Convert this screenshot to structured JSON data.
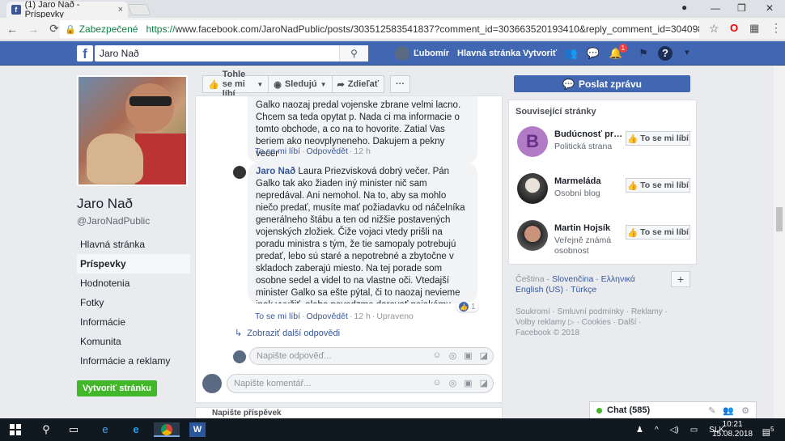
{
  "browser": {
    "tab_title": "(1) Jaro Nað - Príspevky",
    "tab_close": "×",
    "secure_label": "Zabezpečené",
    "url_scheme": "https://",
    "url_rest": "www.facebook.com/JaroNadPublic/posts/303512583541837?comment_id=303663520193410&reply_comment_id=304098803483215&com...",
    "win_min": "—",
    "win_max": "❐",
    "win_close": "✕",
    "back": "←",
    "forward": "→",
    "reload": "⟳",
    "star": "☆",
    "menu": "⋮"
  },
  "fb_header": {
    "search_value": "Jaro Nað",
    "user_name": "Ľubomír",
    "home": "Hlavná stránka",
    "create": "Vytvoriť",
    "notif_count": "1"
  },
  "page": {
    "name": "Jaro Nað",
    "handle": "@JaroNadPublic",
    "nav": [
      {
        "label": "Hlavná stránka"
      },
      {
        "label": "Príspevky"
      },
      {
        "label": "Hodnotenia"
      },
      {
        "label": "Fotky"
      },
      {
        "label": "Informácie"
      },
      {
        "label": "Komunita"
      },
      {
        "label": "Informácie a reklamy"
      }
    ],
    "create_page": "Vytvoriť stránku"
  },
  "actions": {
    "like": "Tohle se mi líbí",
    "follow": "Sledujú",
    "share": "Zdieľať",
    "more": "···"
  },
  "comments": {
    "first_text": "Galko naozaj predal vojenske zbrane velmi lacno. Chcem sa teda opytat p. Nada ci ma informacie o tomto obchode, a co na to hovorite. Zatial Vas beriem ako neovplyneneho. Dakujem a pekny vecer",
    "first_like": "To se mi líbí",
    "first_reply": "Odpovědět",
    "first_time": "12 h",
    "reply_author": "Jaro Nað",
    "reply_text": "Laura Priezvisková dobrý večer. Pán Galko tak ako žiaden iný minister nič sam nepredával. Ani nemohol. Na to, aby sa mohlo niečo predať, musíte mať požiadavku od náčelníka generálneho štábu a ten od nižšie postavených vojenských zložiek. Čiže vojaci vtedy prišli na poradu ministra s tým, že tie samopaly potrebujú predať, lebo sú staré a nepotrebné a zbytočne v skladoch zaberajú miesto. Na tej porade som osobne sedel a videl to na vlastne oči. Vtedajší minister Galko sa ešte pýtal, či to naozaj nevieme inak využiť, alebo povedzme darovať nejakému spojencovi. Prítomný najvyšší vojak povedal, že najlepšia alternatíva je predaj. No a cena bola stanovená na základe elektronickej aukcie. Kto dal viac, ten si to kúpil. Ostatné je iba politikárčenie. Galko v tom bol a je nevinne. Taký je fakt...",
    "reply_like": "To se mi líbí",
    "reply_reply": "Odpovědět",
    "reply_time": "12 h",
    "reply_edited": "Upraveno",
    "reply_reactions": "1",
    "more_replies": "Zobraziť další odpovědi",
    "reply_placeholder": "Napište odpověď...",
    "comment_placeholder": "Napište komentář...",
    "write_post": "Napište příspěvek"
  },
  "right": {
    "message_btn": "Poslat zprávu",
    "related_title": "Související stránky",
    "related": [
      {
        "name": "Budúcnosť pre ...",
        "sub": "Politická strana",
        "btn": "To se mi líbí",
        "letter": "B"
      },
      {
        "name": "Marmeláda",
        "sub": "Osobní blog",
        "btn": "To se mi líbí"
      },
      {
        "name": "Martin Hojsík",
        "sub": "Veřejně známá osobnost",
        "btn": "To se mi líbí"
      }
    ],
    "lang_current": "Čeština",
    "lang1": "Slovenčina",
    "lang2": "Ελληνικά",
    "lang3": "English (US)",
    "lang4": "Türkçe",
    "footer_links": "Soukromí · Smluvní podmínky · Reklamy · Volby reklamy ▷ · Cookies · Další ·",
    "copyright": "Facebook © 2018"
  },
  "chat": {
    "label": "Chat (585)"
  },
  "taskbar": {
    "lang": "SLK",
    "time": "10:21",
    "date": "15.08.2018",
    "notif": "5"
  },
  "colors": {
    "fb_blue": "#4267b2",
    "link": "#365899",
    "green": "#42b72a"
  }
}
